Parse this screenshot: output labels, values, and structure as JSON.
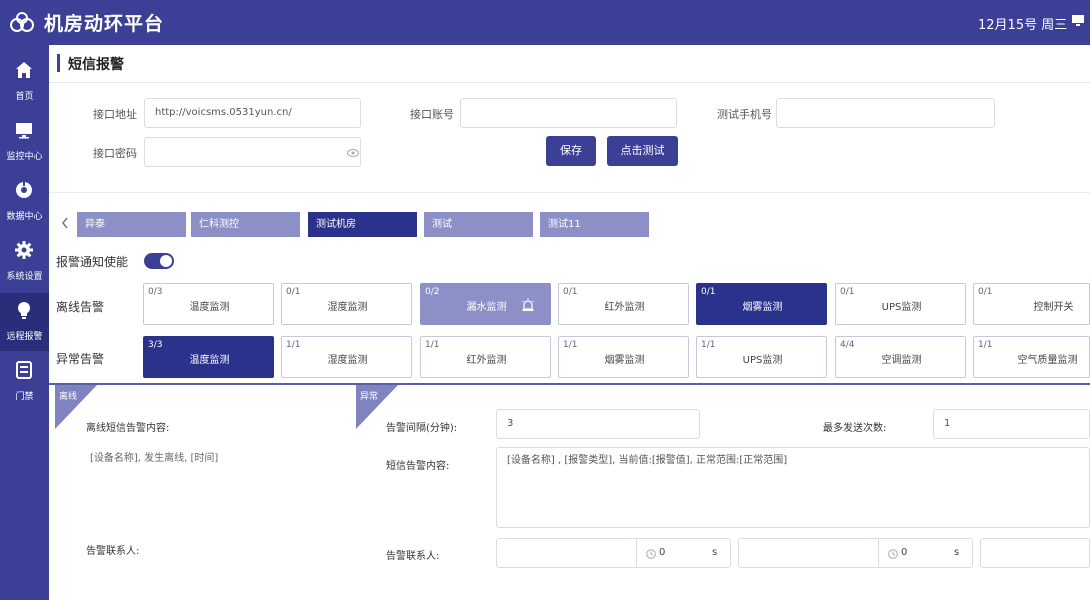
{
  "app": {
    "title": "机房动环平台",
    "date": "12月15号 周三"
  },
  "sidebar": {
    "items": [
      {
        "label": "首页",
        "icon": "home-icon"
      },
      {
        "label": "监控中心",
        "icon": "monitor-icon"
      },
      {
        "label": "数据中心",
        "icon": "data-icon"
      },
      {
        "label": "系统设置",
        "icon": "gear-icon"
      },
      {
        "label": "远程报警",
        "icon": "bulb-icon",
        "active": true
      },
      {
        "label": "门禁",
        "icon": "door-icon"
      }
    ]
  },
  "page": {
    "title": "短信报警"
  },
  "form": {
    "api_address_label": "接口地址",
    "api_address_value": "http://voicsms.0531yun.cn/",
    "api_account_label": "接口账号",
    "api_account_value": "",
    "test_phone_label": "测试手机号",
    "test_phone_value": "",
    "api_password_label": "接口密码",
    "api_password_value": "",
    "save_label": "保存",
    "test_label": "点击测试"
  },
  "rooms": {
    "tabs": [
      "异泰",
      "仁科测控",
      "测试机房",
      "测试",
      "测试11"
    ],
    "active_index": 2
  },
  "alarm_enable": {
    "label": "报警通知使能",
    "enabled": true
  },
  "offline_alarm": {
    "label": "离线告警",
    "cards": [
      {
        "count": "0/3",
        "name": "温度监测"
      },
      {
        "count": "0/1",
        "name": "湿度监测"
      },
      {
        "count": "0/2",
        "name": "漏水监测",
        "state": "light"
      },
      {
        "count": "0/1",
        "name": "红外监测"
      },
      {
        "count": "0/1",
        "name": "烟雾监测",
        "state": "active"
      },
      {
        "count": "0/1",
        "name": "UPS监测"
      },
      {
        "count": "0/1",
        "name": "控制开关"
      }
    ]
  },
  "abnormal_alarm": {
    "label": "异常告警",
    "cards": [
      {
        "count": "3/3",
        "name": "温度监测",
        "state": "active"
      },
      {
        "count": "1/1",
        "name": "湿度监测"
      },
      {
        "count": "1/1",
        "name": "红外监测"
      },
      {
        "count": "1/1",
        "name": "烟雾监测"
      },
      {
        "count": "1/1",
        "name": "UPS监测"
      },
      {
        "count": "4/4",
        "name": "空调监测"
      },
      {
        "count": "1/1",
        "name": "空气质量监测"
      }
    ]
  },
  "offline_panel": {
    "tag": "离线",
    "content_label": "离线短信告警内容:",
    "content_text": "[设备名称], 发生离线, [时间]",
    "contact_label": "告警联系人:"
  },
  "abnormal_panel": {
    "tag": "异常",
    "interval_label": "告警间隔(分钟):",
    "interval_value": "3",
    "max_send_label": "最多发送次数:",
    "max_send_value": "1",
    "content_label": "短信告警内容:",
    "content_text": "[设备名称] , [报警类型], 当前值:[报警值], 正常范围:[正常范围]",
    "contact_label": "告警联系人:",
    "contacts": [
      {
        "value": "0",
        "unit": "s"
      },
      {
        "value": "0",
        "unit": "s"
      },
      {
        "value": "",
        "unit": ""
      }
    ]
  },
  "colors": {
    "primary": "#3b4096",
    "dark": "#2b328c",
    "light": "#8d90c6"
  }
}
